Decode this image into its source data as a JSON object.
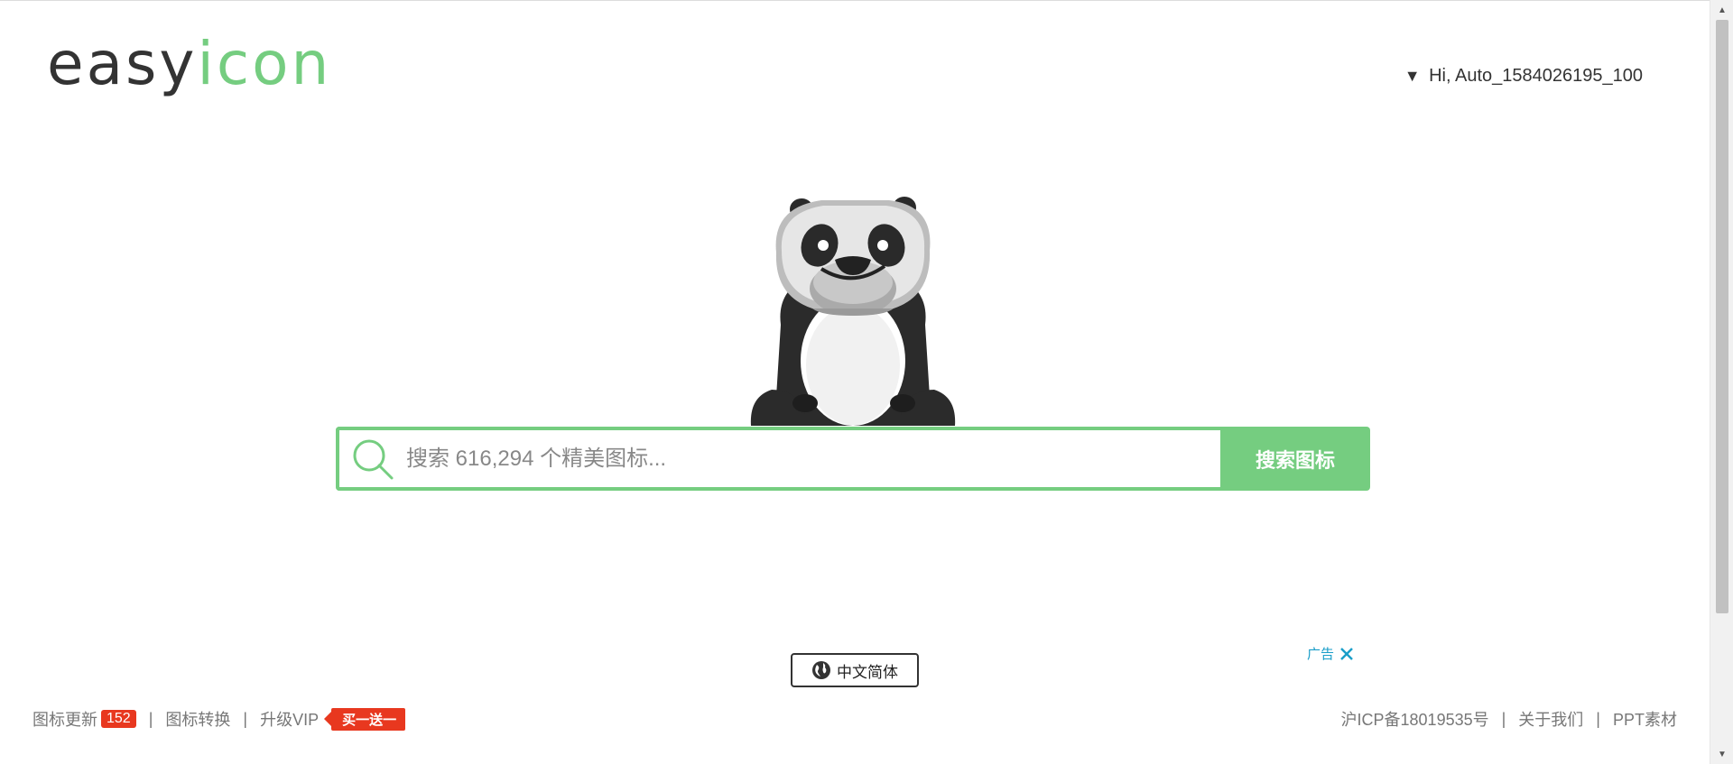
{
  "logo": {
    "part1": "easy",
    "part2": "icon"
  },
  "user_menu": {
    "caret": "▼",
    "label": "Hi, Auto_1584026195_100"
  },
  "search": {
    "placeholder": "搜索 616,294 个精美图标...",
    "button_label": "搜索图标"
  },
  "language": {
    "label": "中文简体"
  },
  "ad": {
    "label": "广告"
  },
  "footer": {
    "left": {
      "updates_label": "图标更新",
      "updates_count": "152",
      "convert_label": "图标转换",
      "vip_label": "升级VIP",
      "promo_label": "买一送一"
    },
    "right": {
      "icp_label": "沪ICP备18019535号",
      "about_label": "关于我们",
      "ppt_label": "PPT素材"
    },
    "separator": "|"
  },
  "colors": {
    "brand_green": "#75cd80",
    "badge_red": "#e8381f",
    "ad_blue": "#1a9ec9"
  },
  "icons": [
    "search-icon",
    "globe-icon",
    "close-icon",
    "panda-mascot"
  ]
}
